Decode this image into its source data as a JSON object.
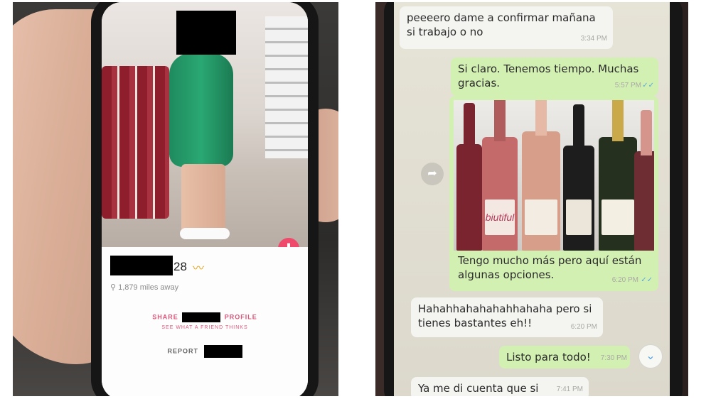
{
  "left_photo": {
    "profile": {
      "age": "28",
      "distance": "1,879 miles away",
      "share_prefix": "SHARE",
      "share_suffix": "PROFILE",
      "see_friend": "SEE WHAT A FRIEND THINKS",
      "report": "REPORT"
    },
    "icons": {
      "dislike": "⬇",
      "wave": "〰"
    }
  },
  "right_photo": {
    "messages": [
      {
        "text": "peeeero dame a confirmar mañana si trabajo o no",
        "time": "3:34 PM",
        "side": "in"
      },
      {
        "text": "Si claro. Tenemos tiempo. Muchas gracias.",
        "time": "5:57 PM",
        "side": "out"
      },
      {
        "text": "Tengo mucho más pero aquí están algunas opciones.",
        "time": "6:20 PM",
        "side": "out"
      },
      {
        "text": "Hahahhahahahahhahaha pero si tienes bastantes eh!!",
        "time": "6:20 PM",
        "side": "in"
      },
      {
        "text": "Listo para todo!",
        "time": "7:30 PM",
        "side": "out"
      },
      {
        "text": "Ya me di cuenta que si",
        "time": "7:41 PM",
        "side": "in"
      }
    ],
    "wine_label": "biutiful",
    "colors": {
      "incoming": "#f4f4f1",
      "outgoing": "#d3f0b3",
      "ticks": "#5aa8e2"
    },
    "icons": {
      "forward": "➦",
      "scroll_down": "⌄",
      "read_ticks": "✓✓"
    }
  }
}
